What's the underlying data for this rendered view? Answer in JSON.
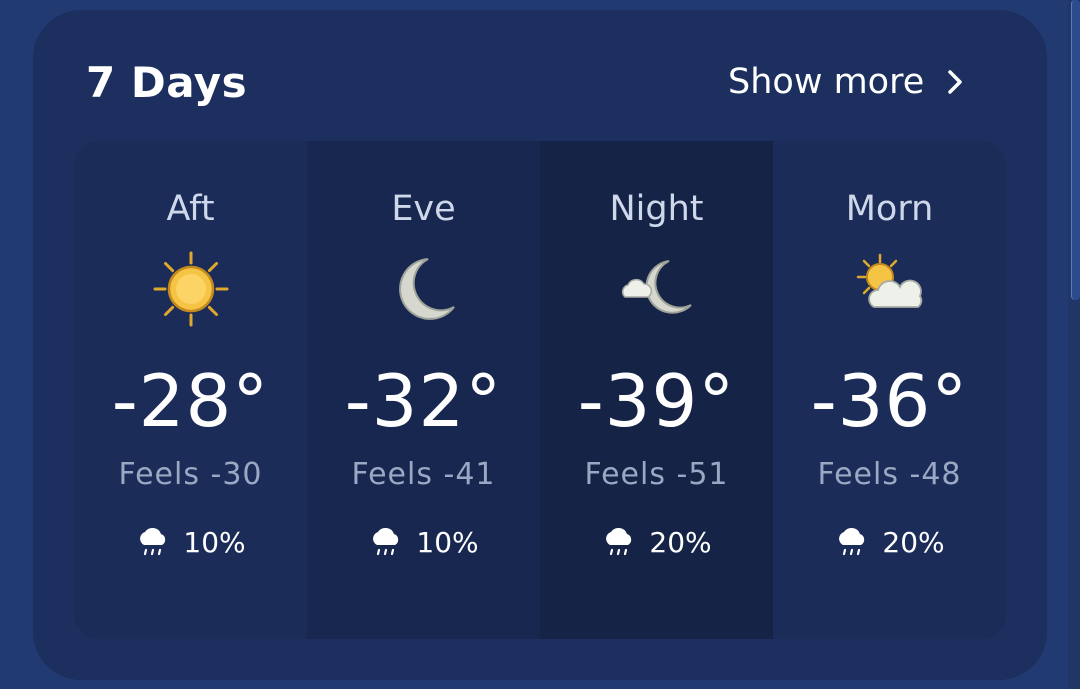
{
  "header": {
    "title": "7 Days",
    "show_more_label": "Show more",
    "show_more_icon": "chevron-right-icon"
  },
  "periods": [
    {
      "label": "Aft",
      "icon": "sun-icon",
      "temp": "-28°",
      "feels": "Feels -30",
      "precip_icon": "rain-cloud-icon",
      "precip": "10%",
      "bg": "#1b2c58"
    },
    {
      "label": "Eve",
      "icon": "moon-icon",
      "temp": "-32°",
      "feels": "Feels -41",
      "precip_icon": "rain-cloud-icon",
      "precip": "10%",
      "bg": "#172750"
    },
    {
      "label": "Night",
      "icon": "cloud-moon-icon",
      "temp": "-39°",
      "feels": "Feels -51",
      "precip_icon": "rain-cloud-icon",
      "precip": "20%",
      "bg": "#152346"
    },
    {
      "label": "Morn",
      "icon": "sun-cloud-icon",
      "temp": "-36°",
      "feels": "Feels -48",
      "precip_icon": "rain-cloud-icon",
      "precip": "20%",
      "bg": "#1b2c58"
    }
  ],
  "colors": {
    "background": "#213b72",
    "card": "#1c2f5e",
    "text_primary": "#ffffff",
    "text_secondary": "#9aa8c4",
    "sun": "#f6c445"
  }
}
